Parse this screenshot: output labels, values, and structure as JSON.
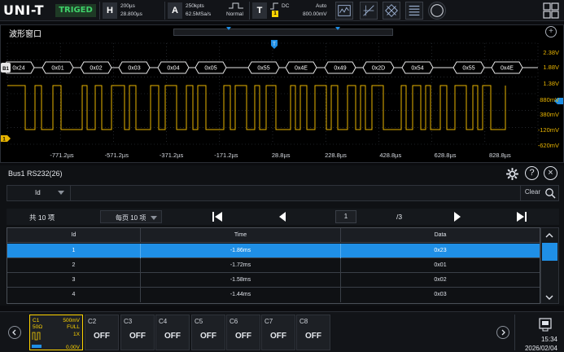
{
  "topbar": {
    "brand": "UNI-T",
    "trigger_state": "TRIGED",
    "horizontal_key": "H",
    "timebase": "200µs",
    "horizontal_position": "28.800µs",
    "acquire_key": "A",
    "memory_depth": "250kpts",
    "sample_rate": "62.5MSa/s",
    "acquire_mode": "Normal",
    "trigger_key": "T",
    "trigger_coupling": "DC",
    "trigger_mode": "Auto",
    "trigger_level": "800.00mV",
    "trigger_source_badge": "1"
  },
  "wave_window": {
    "title": "波形窗口",
    "zoom_label": "+",
    "bus_label": "B1",
    "ch1_label": "1",
    "trigger_marker": "T",
    "decoded_bytes": [
      "0x24",
      "0x01",
      "0x02",
      "0x03",
      "0x04",
      "0x05",
      "0x55",
      "0x4E",
      "0x49",
      "0x2D",
      "0x54",
      "0x55",
      "0x4E"
    ],
    "time_ticks": [
      "-771.2µs",
      "-571.2µs",
      "-371.2µs",
      "-171.2µs",
      "28.8µs",
      "228.8µs",
      "428.8µs",
      "628.8µs",
      "828.8µs"
    ],
    "voltage_ticks": [
      "2.38V",
      "1.88V",
      "1.38V",
      "880mV",
      "380mV",
      "-120mV",
      "-620mV"
    ],
    "colors": {
      "ch1": "#e8b400",
      "bus": "#e6e6e6",
      "grid": "#3a3f47"
    }
  },
  "bus_panel": {
    "title": "Bus1 RS232(26)",
    "settings_icon": "gear-icon",
    "help_label": "?",
    "close_label": "×",
    "search": {
      "field_label": "Id",
      "value": "",
      "clear_label": "Clear"
    },
    "pager": {
      "total": "共 10 项",
      "per_page": "每页 10 项",
      "current_page": "1",
      "total_pages": "/3"
    },
    "table": {
      "headers": [
        "Id",
        "Time",
        "Data"
      ],
      "rows": [
        {
          "id": "1",
          "time": "-1.86ms",
          "data": "0x23",
          "selected": true
        },
        {
          "id": "2",
          "time": "-1.72ms",
          "data": "0x01",
          "selected": false
        },
        {
          "id": "3",
          "time": "-1.58ms",
          "data": "0x02",
          "selected": false
        },
        {
          "id": "4",
          "time": "-1.44ms",
          "data": "0x03",
          "selected": false
        }
      ]
    }
  },
  "bottombar": {
    "ch1": {
      "name": "C1",
      "scale": "500mV",
      "impedance": "50Ω",
      "bandwidth": "FULL",
      "probe": "1X",
      "offset": "0.00V"
    },
    "channels": [
      {
        "name": "C2",
        "state": "OFF"
      },
      {
        "name": "C3",
        "state": "OFF"
      },
      {
        "name": "C4",
        "state": "OFF"
      },
      {
        "name": "C5",
        "state": "OFF"
      },
      {
        "name": "C6",
        "state": "OFF"
      },
      {
        "name": "C7",
        "state": "OFF"
      },
      {
        "name": "C8",
        "state": "OFF"
      }
    ],
    "time": "15:34",
    "date": "2026/02/04"
  }
}
